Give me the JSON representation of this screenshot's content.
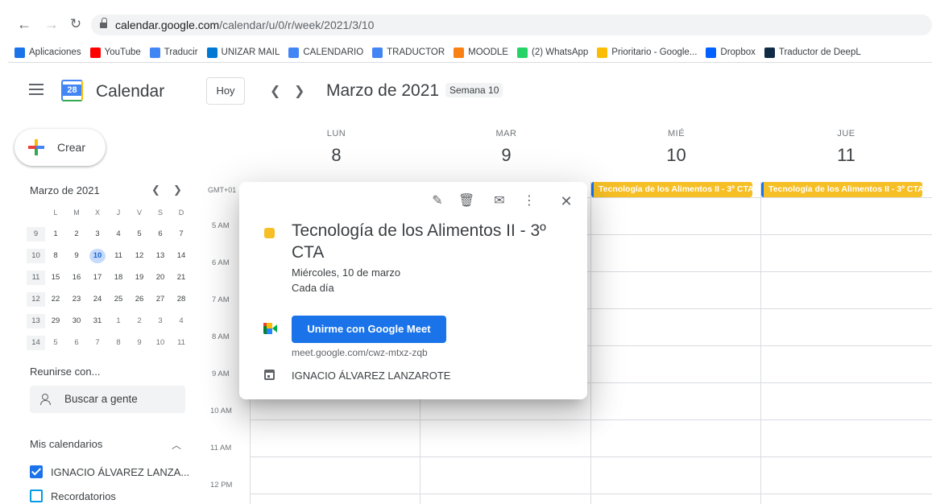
{
  "browser": {
    "url_host": "calendar.google.com",
    "url_path": "/calendar/u/0/r/week/2021/3/10",
    "bookmarks": [
      {
        "label": "Aplicaciones",
        "icon": "apps-grid-icon",
        "color": "#1a73e8"
      },
      {
        "label": "YouTube",
        "icon": "youtube-icon",
        "color": "#ff0000"
      },
      {
        "label": "Traducir",
        "icon": "translate-icon",
        "color": "#4285f4"
      },
      {
        "label": "UNIZAR MAIL",
        "icon": "mail-cloud-icon",
        "color": "#0078d4"
      },
      {
        "label": "CALENDARIO",
        "icon": "calendar-icon",
        "color": "#4285f4"
      },
      {
        "label": "TRADUCTOR",
        "icon": "translate-icon",
        "color": "#4285f4"
      },
      {
        "label": "MOODLE",
        "icon": "moodle-icon",
        "color": "#f98012"
      },
      {
        "label": "(2) WhatsApp",
        "icon": "whatsapp-icon",
        "color": "#25d366"
      },
      {
        "label": "Prioritario - Google...",
        "icon": "drive-icon",
        "color": "#fbbc04"
      },
      {
        "label": "Dropbox",
        "icon": "dropbox-icon",
        "color": "#0061ff"
      },
      {
        "label": "Traductor de DeepL",
        "icon": "deepl-icon",
        "color": "#0f2b46"
      }
    ]
  },
  "header": {
    "app_title": "Calendar",
    "logo_day": "28",
    "today_label": "Hoy",
    "period_title": "Marzo de 2021",
    "week_badge": "Semana 10"
  },
  "sidebar": {
    "create_label": "Crear",
    "mini_calendar": {
      "title": "Marzo de 2021",
      "weekdays": [
        "L",
        "M",
        "X",
        "J",
        "V",
        "S",
        "D"
      ],
      "weeks": [
        {
          "num": "9",
          "days": [
            "1",
            "2",
            "3",
            "4",
            "5",
            "6",
            "7"
          ]
        },
        {
          "num": "10",
          "days": [
            "8",
            "9",
            "10",
            "11",
            "12",
            "13",
            "14"
          ]
        },
        {
          "num": "11",
          "days": [
            "15",
            "16",
            "17",
            "18",
            "19",
            "20",
            "21"
          ]
        },
        {
          "num": "12",
          "days": [
            "22",
            "23",
            "24",
            "25",
            "26",
            "27",
            "28"
          ]
        },
        {
          "num": "13",
          "days": [
            "29",
            "30",
            "31",
            "1",
            "2",
            "3",
            "4"
          ]
        },
        {
          "num": "14",
          "days": [
            "5",
            "6",
            "7",
            "8",
            "9",
            "10",
            "11"
          ]
        }
      ],
      "selected_day": "10"
    },
    "meet_with_title": "Reunirse con...",
    "search_people_placeholder": "Buscar a gente",
    "my_calendars_title": "Mis calendarios",
    "calendars": [
      {
        "label": "IGNACIO ÁLVAREZ LANZA...",
        "checked": true,
        "color": "#1a73e8"
      },
      {
        "label": "Recordatorios",
        "checked": false,
        "color": "#039be5"
      }
    ]
  },
  "week": {
    "timezone": "GMT+01",
    "days": [
      {
        "name": "LUN",
        "num": "8"
      },
      {
        "name": "MAR",
        "num": "9"
      },
      {
        "name": "MIÉ",
        "num": "10"
      },
      {
        "name": "JUE",
        "num": "11"
      }
    ],
    "hours": [
      "5 AM",
      "6 AM",
      "7 AM",
      "8 AM",
      "9 AM",
      "10 AM",
      "11 AM",
      "12 PM"
    ],
    "all_day_events": [
      {
        "day": "MIÉ",
        "title": "Tecnología de los Alimentos II - 3º CTA",
        "color": "#f6bf26"
      },
      {
        "day": "JUE",
        "title": "Tecnología de los Alimentos II - 3º CTA",
        "color": "#f6bf26"
      }
    ]
  },
  "event_popup": {
    "title": "Tecnología de los Alimentos II - 3º CTA",
    "date": "Miércoles, 10 de marzo",
    "recurrence": "Cada día",
    "join_label": "Unirme con Google Meet",
    "meet_link": "meet.google.com/cwz-mtxz-zqb",
    "organizer": "IGNACIO ÁLVAREZ LANZAROTE",
    "color": "#f6bf26"
  }
}
